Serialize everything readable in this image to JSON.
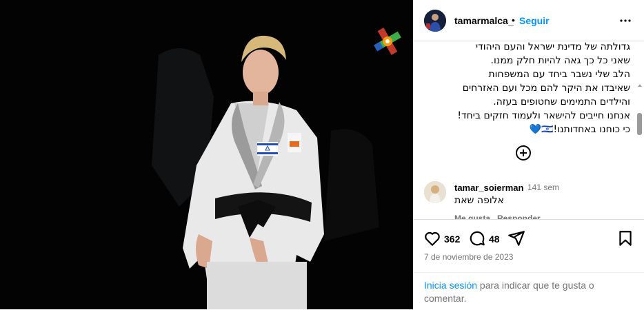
{
  "post": {
    "username": "tamarmalca_",
    "separator": "•",
    "follow_label": "Seguir",
    "more_icon": "more-horizontal-icon"
  },
  "caption": {
    "lines": [
      "גדולתה של מדינת ישראל והעם היהודי",
      "שאני כל כך גאה להיות חלק ממנו.",
      "הלב שלי נשבר ביחד עם המשפחות",
      "שאיבדו את היקר להם מכל ועם האזרחים",
      "והילדים התמימים שחטופים בעזה.",
      "אנחנו חייבים להישאר ולעמוד חזקים ביחד!",
      "כי כוחנו באחדותנו!🇮🇱"
    ],
    "heart": "💙"
  },
  "load_more_icon": "plus-circle-icon",
  "comment": {
    "username": "tamar_soierman",
    "time": "141 sem",
    "text": "אלופה שאת",
    "likes_label": "Me gusta",
    "reply_label": "Responder"
  },
  "actions": {
    "likes_count": "362",
    "comments_count": "48",
    "date": "7 de noviembre de 2023"
  },
  "login": {
    "link_text": "Inicia sesión",
    "rest_text": " para indicar que te gusta o comentar."
  },
  "colors": {
    "link_blue": "#0095f6",
    "muted": "#737373",
    "divider": "#dbdbdb"
  }
}
